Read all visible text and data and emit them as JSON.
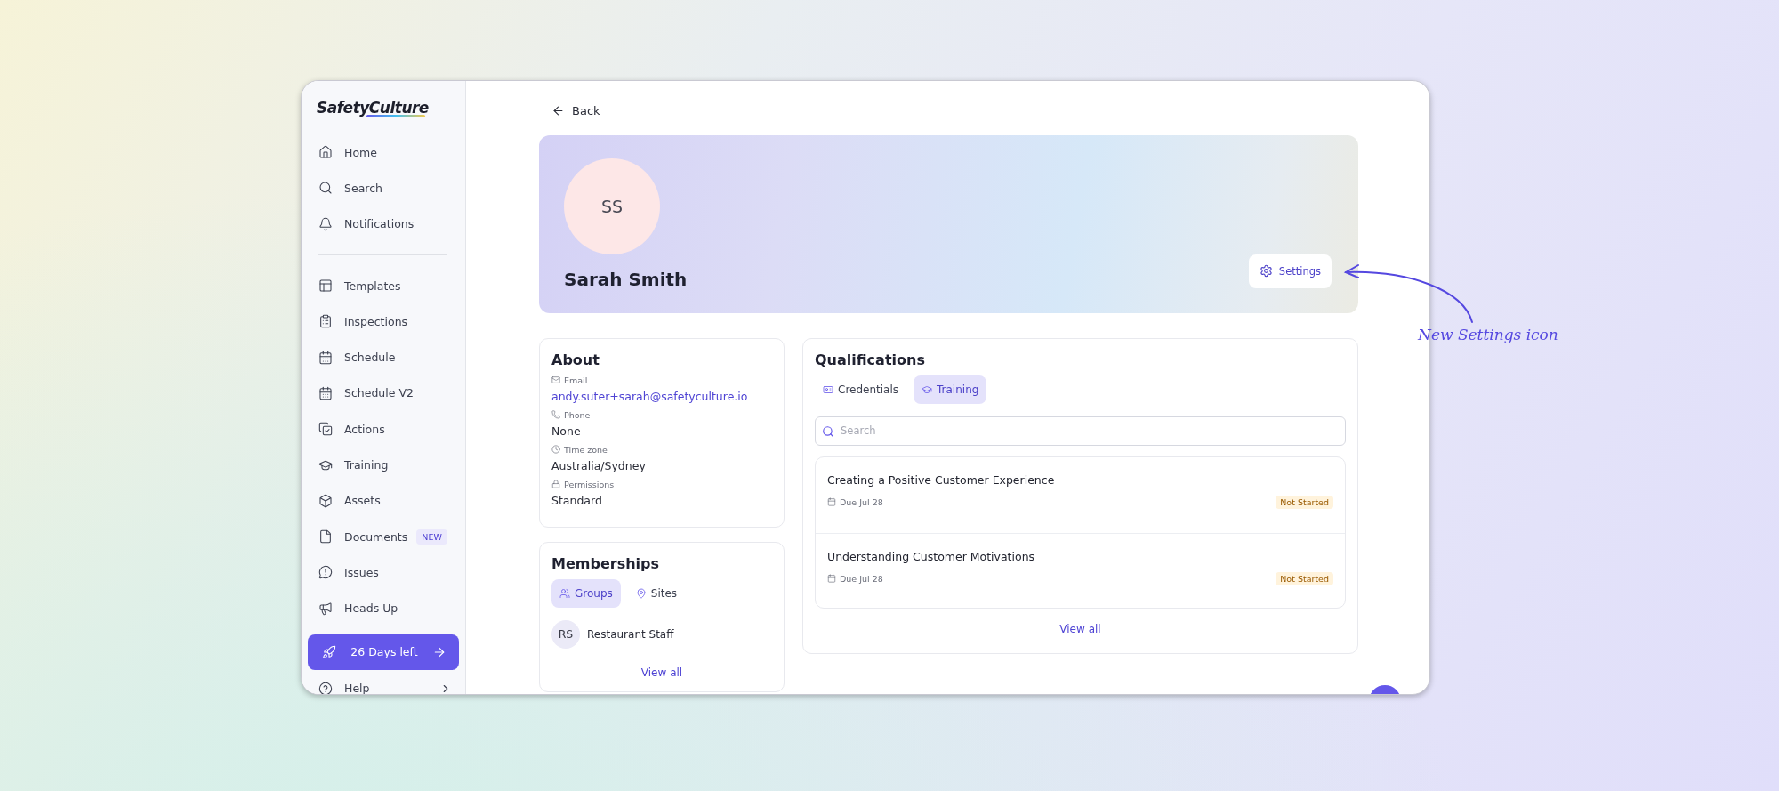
{
  "sidebar": {
    "logo": "SafetyCulture",
    "top_items": [
      {
        "label": "Home"
      },
      {
        "label": "Search"
      },
      {
        "label": "Notifications"
      }
    ],
    "items": [
      {
        "label": "Templates"
      },
      {
        "label": "Inspections"
      },
      {
        "label": "Schedule"
      },
      {
        "label": "Schedule V2"
      },
      {
        "label": "Actions"
      },
      {
        "label": "Training"
      },
      {
        "label": "Assets"
      },
      {
        "label": "Documents",
        "badge": "NEW"
      },
      {
        "label": "Issues"
      },
      {
        "label": "Heads Up"
      }
    ],
    "trial_button": "26 Days left",
    "help": "Help"
  },
  "back": "Back",
  "profile": {
    "initials": "SS",
    "name": "Sarah Smith",
    "settings_button": "Settings"
  },
  "about": {
    "title": "About",
    "fields": [
      {
        "label": "Email",
        "value": "andy.suter+sarah@safetyculture.io",
        "kind": "link"
      },
      {
        "label": "Phone",
        "value": "None",
        "kind": "text"
      },
      {
        "label": "Time zone",
        "value": "Australia/Sydney",
        "kind": "text"
      },
      {
        "label": "Permissions",
        "value": "Standard",
        "kind": "text"
      }
    ]
  },
  "memberships": {
    "title": "Memberships",
    "tabs": [
      {
        "label": "Groups",
        "selected": true
      },
      {
        "label": "Sites",
        "selected": false
      }
    ],
    "items": [
      {
        "initials": "RS",
        "name": "Restaurant Staff"
      }
    ],
    "view_all": "View all"
  },
  "qualifications": {
    "title": "Qualifications",
    "tabs": [
      {
        "label": "Credentials",
        "selected": false
      },
      {
        "label": "Training",
        "selected": true
      }
    ],
    "search": {
      "placeholder": "Search"
    },
    "courses": [
      {
        "title": "Creating a Positive Customer Experience",
        "due": "Due Jul 28",
        "status": "Not Started"
      },
      {
        "title": "Understanding Customer Motivations",
        "due": "Due Jul 28",
        "status": "Not Started"
      }
    ],
    "view_all": "View all"
  },
  "annotation": "New Settings icon"
}
